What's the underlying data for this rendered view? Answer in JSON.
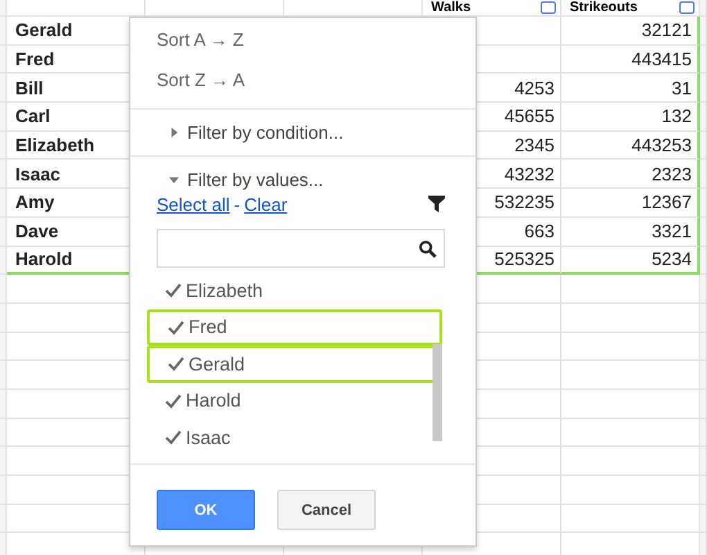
{
  "sheet": {
    "headers": [
      "Walks",
      "Strikeouts"
    ],
    "rows": [
      {
        "name": "Gerald",
        "walks": "",
        "strikeouts": "32121"
      },
      {
        "name": "Fred",
        "walks": "",
        "strikeouts": "443415"
      },
      {
        "name": "Bill",
        "walks": "4253",
        "strikeouts": "31"
      },
      {
        "name": "Carl",
        "walks": "45655",
        "strikeouts": "132"
      },
      {
        "name": "Elizabeth",
        "walks": "2345",
        "strikeouts": "443253"
      },
      {
        "name": "Isaac",
        "walks": "43232",
        "strikeouts": "2323"
      },
      {
        "name": "Amy",
        "walks": "532235",
        "strikeouts": "12367"
      },
      {
        "name": "Dave",
        "walks": "663",
        "strikeouts": "3321"
      },
      {
        "name": "Harold",
        "walks": "525325",
        "strikeouts": "5234"
      }
    ]
  },
  "filter_menu": {
    "sort": [
      "Sort A → Z",
      "Sort Z → A"
    ],
    "condition": {
      "label": "Filter by condition...",
      "expanded": false
    },
    "values": {
      "label": "Filter by values...",
      "expanded": true
    },
    "select_all": "Select all",
    "separator": "-",
    "clear": "Clear",
    "items": [
      {
        "label": "Elizabeth",
        "checked": true,
        "highlighted": false
      },
      {
        "label": "Fred",
        "checked": true,
        "highlighted": true
      },
      {
        "label": "Gerald",
        "checked": true,
        "highlighted": true
      },
      {
        "label": "Harold",
        "checked": true,
        "highlighted": false
      },
      {
        "label": "Isaac",
        "checked": true,
        "highlighted": false
      }
    ],
    "buttons": [
      "OK",
      "Cancel"
    ]
  }
}
